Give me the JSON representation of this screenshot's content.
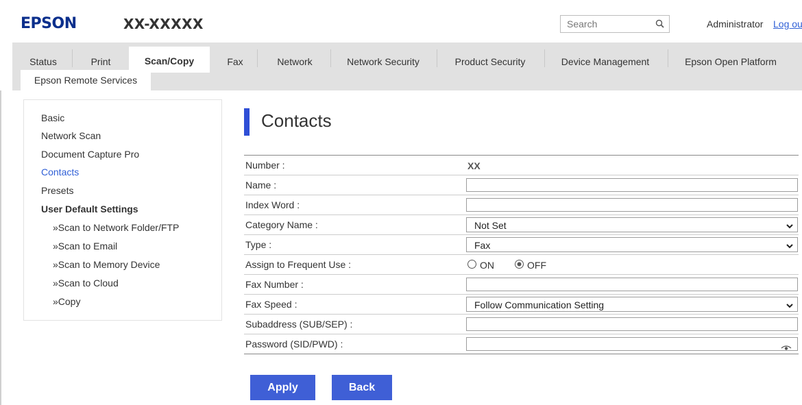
{
  "header": {
    "brand": "EPSON",
    "model": "XX-XXXXX",
    "search_placeholder": "Search",
    "user_label": "Administrator",
    "logout_label": "Log ou"
  },
  "tabs": [
    {
      "label": "Status"
    },
    {
      "label": "Print"
    },
    {
      "label": "Scan/Copy",
      "active": true
    },
    {
      "label": "Fax"
    },
    {
      "label": "Network"
    },
    {
      "label": "Network Security"
    },
    {
      "label": "Product Security"
    },
    {
      "label": "Device Management"
    },
    {
      "label": "Epson Open Platform"
    },
    {
      "label": "Epson Remote Services"
    }
  ],
  "sidebar": {
    "items": [
      {
        "label": "Basic"
      },
      {
        "label": "Network Scan"
      },
      {
        "label": "Document Capture Pro"
      },
      {
        "label": "Contacts",
        "active": true
      },
      {
        "label": "Presets"
      }
    ],
    "heading": "User Default Settings",
    "subitems": [
      {
        "label": "»Scan to Network Folder/FTP"
      },
      {
        "label": "»Scan to Email"
      },
      {
        "label": "»Scan to Memory Device"
      },
      {
        "label": "»Scan to Cloud"
      },
      {
        "label": "»Copy"
      }
    ]
  },
  "page": {
    "title": "Contacts"
  },
  "form": {
    "number": {
      "label": "Number :",
      "value": "XX"
    },
    "name": {
      "label": "Name :",
      "value": ""
    },
    "index_word": {
      "label": "Index Word :",
      "value": ""
    },
    "category": {
      "label": "Category Name :",
      "value": "Not Set"
    },
    "type": {
      "label": "Type :",
      "value": "Fax"
    },
    "frequent": {
      "label": "Assign to Frequent Use :",
      "on_label": "ON",
      "off_label": "OFF",
      "selected": "OFF"
    },
    "fax_number": {
      "label": "Fax Number :",
      "value": ""
    },
    "fax_speed": {
      "label": "Fax Speed :",
      "value": "Follow Communication Setting"
    },
    "subaddress": {
      "label": "Subaddress (SUB/SEP) :",
      "value": ""
    },
    "password": {
      "label": "Password (SID/PWD) :",
      "value": ""
    }
  },
  "buttons": {
    "apply": "Apply",
    "back": "Back"
  },
  "colors": {
    "brand": "#0b2f8c",
    "accent": "#3f5fd6",
    "link": "#2f5fd6",
    "tabbar": "#e1e1e1"
  },
  "icons": [
    "search-icon",
    "chevron-down-icon",
    "eye-icon",
    "radio-icon"
  ]
}
